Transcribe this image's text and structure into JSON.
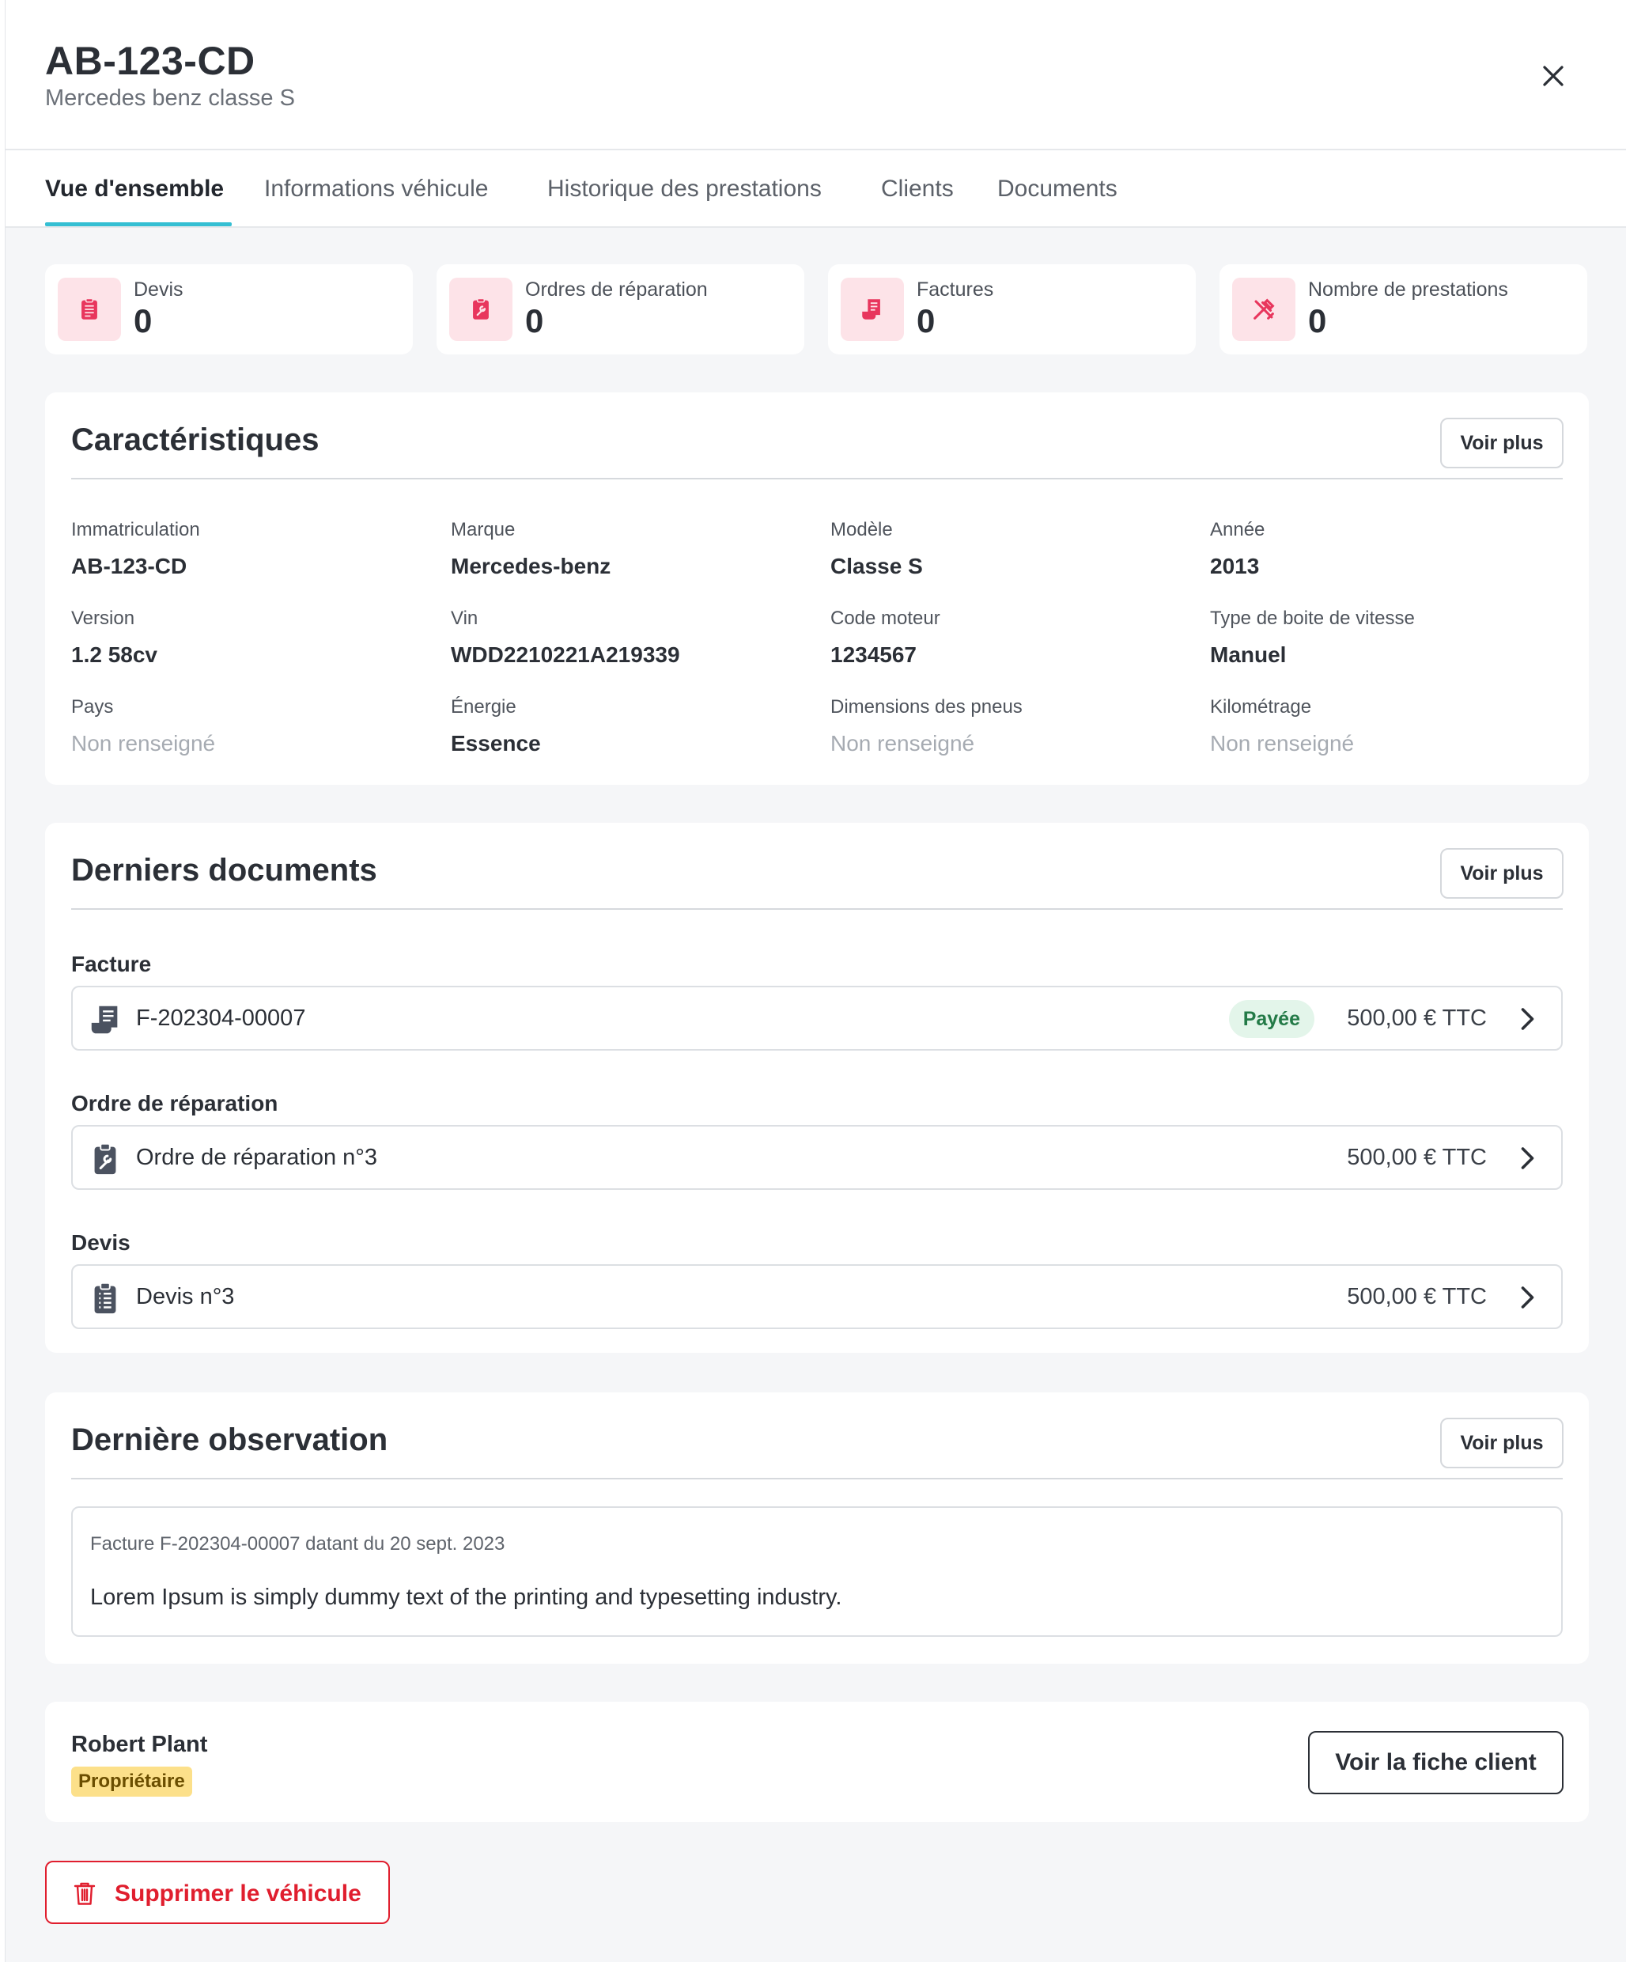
{
  "header": {
    "title": "AB-123-CD",
    "subtitle": "Mercedes benz classe S",
    "close_icon": "close-icon"
  },
  "tabs": [
    {
      "label": "Vue d'ensemble",
      "active": true
    },
    {
      "label": "Informations véhicule",
      "active": false
    },
    {
      "label": "Historique des prestations",
      "active": false
    },
    {
      "label": "Clients",
      "active": false
    },
    {
      "label": "Documents",
      "active": false
    }
  ],
  "stats": [
    {
      "label": "Devis",
      "value": "0",
      "icon": "quote-list-icon"
    },
    {
      "label": "Ordres de réparation",
      "value": "0",
      "icon": "repair-order-icon"
    },
    {
      "label": "Factures",
      "value": "0",
      "icon": "invoice-icon"
    },
    {
      "label": "Nombre de prestations",
      "value": "0",
      "icon": "tools-icon"
    }
  ],
  "characteristics": {
    "title": "Caractéristiques",
    "more_label": "Voir plus",
    "fields": [
      {
        "label": "Immatriculation",
        "value": "AB-123-CD",
        "empty": false
      },
      {
        "label": "Marque",
        "value": "Mercedes-benz",
        "empty": false
      },
      {
        "label": "Modèle",
        "value": "Classe S",
        "empty": false
      },
      {
        "label": "Année",
        "value": "2013",
        "empty": false
      },
      {
        "label": "Version",
        "value": "1.2 58cv",
        "empty": false
      },
      {
        "label": "Vin",
        "value": "WDD2210221A219339",
        "empty": false
      },
      {
        "label": "Code moteur",
        "value": "1234567",
        "empty": false
      },
      {
        "label": "Type de boite de vitesse",
        "value": "Manuel",
        "empty": false
      },
      {
        "label": "Pays",
        "value": "Non renseigné",
        "empty": true
      },
      {
        "label": "Énergie",
        "value": "Essence",
        "empty": false
      },
      {
        "label": "Dimensions des pneus",
        "value": "Non renseigné",
        "empty": true
      },
      {
        "label": "Kilométrage",
        "value": "Non renseigné",
        "empty": true
      }
    ]
  },
  "documents": {
    "title": "Derniers documents",
    "more_label": "Voir plus",
    "groups": [
      {
        "label": "Facture",
        "name": "F-202304-00007",
        "status": "Payée",
        "amount": "500,00 € TTC",
        "icon": "invoice-icon"
      },
      {
        "label": "Ordre de réparation",
        "name": "Ordre de réparation n°3",
        "amount": "500,00 € TTC",
        "icon": "repair-order-icon"
      },
      {
        "label": "Devis",
        "name": "Devis n°3",
        "amount": "500,00 € TTC",
        "icon": "quote-list-icon"
      }
    ]
  },
  "observation": {
    "title": "Dernière observation",
    "more_label": "Voir plus",
    "meta": "Facture F-202304-00007 datant du 20 sept. 2023",
    "text": "Lorem Ipsum is simply dummy text of the printing and typesetting industry."
  },
  "client": {
    "name": "Robert Plant",
    "role": "Propriétaire",
    "button_label": "Voir la fiche client"
  },
  "delete_label": "Supprimer le véhicule",
  "colors": {
    "accent": "#35bfd3",
    "icon_pink": "#e8365d",
    "icon_bg": "#fde3e8",
    "danger": "#e01e2e",
    "paid_bg": "#e3f5ea",
    "owner_bg": "#fce08a"
  }
}
